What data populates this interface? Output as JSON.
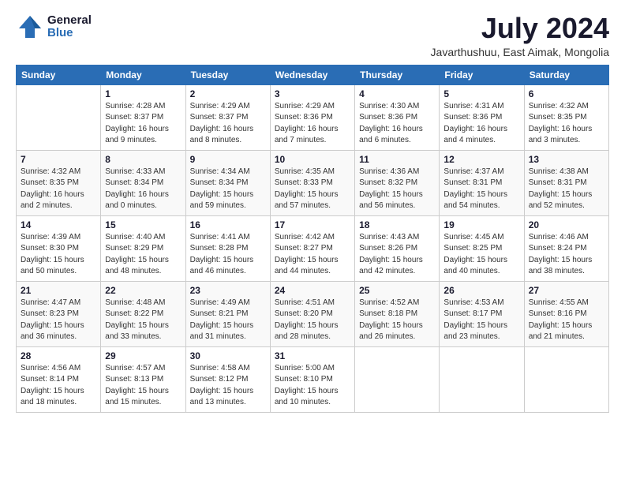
{
  "logo": {
    "general": "General",
    "blue": "Blue"
  },
  "title": "July 2024",
  "location": "Javarthushuu, East Aimak, Mongolia",
  "headers": [
    "Sunday",
    "Monday",
    "Tuesday",
    "Wednesday",
    "Thursday",
    "Friday",
    "Saturday"
  ],
  "weeks": [
    [
      {
        "day": "",
        "info": ""
      },
      {
        "day": "1",
        "info": "Sunrise: 4:28 AM\nSunset: 8:37 PM\nDaylight: 16 hours\nand 9 minutes."
      },
      {
        "day": "2",
        "info": "Sunrise: 4:29 AM\nSunset: 8:37 PM\nDaylight: 16 hours\nand 8 minutes."
      },
      {
        "day": "3",
        "info": "Sunrise: 4:29 AM\nSunset: 8:36 PM\nDaylight: 16 hours\nand 7 minutes."
      },
      {
        "day": "4",
        "info": "Sunrise: 4:30 AM\nSunset: 8:36 PM\nDaylight: 16 hours\nand 6 minutes."
      },
      {
        "day": "5",
        "info": "Sunrise: 4:31 AM\nSunset: 8:36 PM\nDaylight: 16 hours\nand 4 minutes."
      },
      {
        "day": "6",
        "info": "Sunrise: 4:32 AM\nSunset: 8:35 PM\nDaylight: 16 hours\nand 3 minutes."
      }
    ],
    [
      {
        "day": "7",
        "info": "Sunrise: 4:32 AM\nSunset: 8:35 PM\nDaylight: 16 hours\nand 2 minutes."
      },
      {
        "day": "8",
        "info": "Sunrise: 4:33 AM\nSunset: 8:34 PM\nDaylight: 16 hours\nand 0 minutes."
      },
      {
        "day": "9",
        "info": "Sunrise: 4:34 AM\nSunset: 8:34 PM\nDaylight: 15 hours\nand 59 minutes."
      },
      {
        "day": "10",
        "info": "Sunrise: 4:35 AM\nSunset: 8:33 PM\nDaylight: 15 hours\nand 57 minutes."
      },
      {
        "day": "11",
        "info": "Sunrise: 4:36 AM\nSunset: 8:32 PM\nDaylight: 15 hours\nand 56 minutes."
      },
      {
        "day": "12",
        "info": "Sunrise: 4:37 AM\nSunset: 8:31 PM\nDaylight: 15 hours\nand 54 minutes."
      },
      {
        "day": "13",
        "info": "Sunrise: 4:38 AM\nSunset: 8:31 PM\nDaylight: 15 hours\nand 52 minutes."
      }
    ],
    [
      {
        "day": "14",
        "info": "Sunrise: 4:39 AM\nSunset: 8:30 PM\nDaylight: 15 hours\nand 50 minutes."
      },
      {
        "day": "15",
        "info": "Sunrise: 4:40 AM\nSunset: 8:29 PM\nDaylight: 15 hours\nand 48 minutes."
      },
      {
        "day": "16",
        "info": "Sunrise: 4:41 AM\nSunset: 8:28 PM\nDaylight: 15 hours\nand 46 minutes."
      },
      {
        "day": "17",
        "info": "Sunrise: 4:42 AM\nSunset: 8:27 PM\nDaylight: 15 hours\nand 44 minutes."
      },
      {
        "day": "18",
        "info": "Sunrise: 4:43 AM\nSunset: 8:26 PM\nDaylight: 15 hours\nand 42 minutes."
      },
      {
        "day": "19",
        "info": "Sunrise: 4:45 AM\nSunset: 8:25 PM\nDaylight: 15 hours\nand 40 minutes."
      },
      {
        "day": "20",
        "info": "Sunrise: 4:46 AM\nSunset: 8:24 PM\nDaylight: 15 hours\nand 38 minutes."
      }
    ],
    [
      {
        "day": "21",
        "info": "Sunrise: 4:47 AM\nSunset: 8:23 PM\nDaylight: 15 hours\nand 36 minutes."
      },
      {
        "day": "22",
        "info": "Sunrise: 4:48 AM\nSunset: 8:22 PM\nDaylight: 15 hours\nand 33 minutes."
      },
      {
        "day": "23",
        "info": "Sunrise: 4:49 AM\nSunset: 8:21 PM\nDaylight: 15 hours\nand 31 minutes."
      },
      {
        "day": "24",
        "info": "Sunrise: 4:51 AM\nSunset: 8:20 PM\nDaylight: 15 hours\nand 28 minutes."
      },
      {
        "day": "25",
        "info": "Sunrise: 4:52 AM\nSunset: 8:18 PM\nDaylight: 15 hours\nand 26 minutes."
      },
      {
        "day": "26",
        "info": "Sunrise: 4:53 AM\nSunset: 8:17 PM\nDaylight: 15 hours\nand 23 minutes."
      },
      {
        "day": "27",
        "info": "Sunrise: 4:55 AM\nSunset: 8:16 PM\nDaylight: 15 hours\nand 21 minutes."
      }
    ],
    [
      {
        "day": "28",
        "info": "Sunrise: 4:56 AM\nSunset: 8:14 PM\nDaylight: 15 hours\nand 18 minutes."
      },
      {
        "day": "29",
        "info": "Sunrise: 4:57 AM\nSunset: 8:13 PM\nDaylight: 15 hours\nand 15 minutes."
      },
      {
        "day": "30",
        "info": "Sunrise: 4:58 AM\nSunset: 8:12 PM\nDaylight: 15 hours\nand 13 minutes."
      },
      {
        "day": "31",
        "info": "Sunrise: 5:00 AM\nSunset: 8:10 PM\nDaylight: 15 hours\nand 10 minutes."
      },
      {
        "day": "",
        "info": ""
      },
      {
        "day": "",
        "info": ""
      },
      {
        "day": "",
        "info": ""
      }
    ]
  ]
}
